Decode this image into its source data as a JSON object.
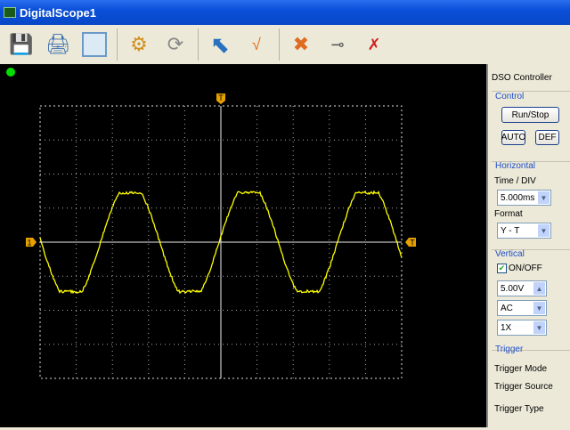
{
  "window": {
    "title": "DigitalScope1"
  },
  "toolbar": {
    "buttons": [
      "save-icon",
      "print-icon",
      "layout-icon",
      "settings-icon",
      "refresh-icon",
      "cursor-icon",
      "math-icon",
      "tools-icon",
      "usb-icon",
      "usb-disconnect-icon"
    ]
  },
  "panel": {
    "title": "DSO Controller",
    "control": {
      "label": "Control",
      "run_stop": "Run/Stop",
      "auto": "AUTO",
      "def": "DEF"
    },
    "horizontal": {
      "label": "Horizontal",
      "time_div_label": "Time / DIV",
      "time_div": "5.000ms",
      "format_label": "Format",
      "format": "Y - T"
    },
    "vertical": {
      "label": "Vertical",
      "onoff": "ON/OFF",
      "onoff_checked": true,
      "volts_div": "5.00V",
      "coupling": "AC",
      "probe": "1X"
    },
    "trigger": {
      "label": "Trigger",
      "mode_label": "Trigger Mode",
      "source_label": "Trigger Source",
      "type_label": "Trigger Type"
    }
  },
  "scope": {
    "status_color": "#00e000",
    "trace_color": "#ffff00",
    "channel_marker": "1",
    "trigger_marker": "T",
    "top_marker": "T",
    "waveform": {
      "period_div": 3.28,
      "rising_zero_div": 1.67,
      "amplitude_div": 1.75,
      "clip_div": 1.45
    }
  }
}
